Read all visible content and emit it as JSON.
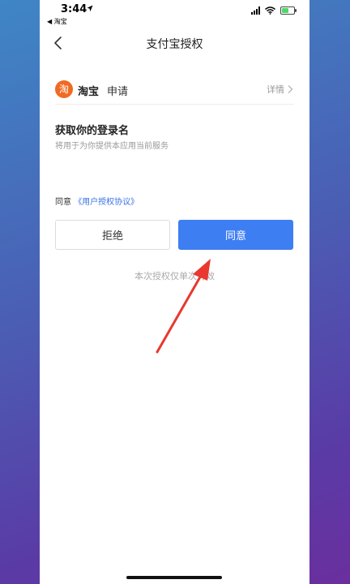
{
  "status_bar": {
    "time": "3:44",
    "back_app": "◀ 淘宝",
    "location_icon": "location-arrow-icon",
    "battery_charging": true,
    "battery_level": 0.6
  },
  "nav": {
    "title": "支付宝授权",
    "back_icon": "chevron-left-icon"
  },
  "app_request": {
    "logo_glyph": "淘",
    "app_name": "淘宝",
    "action": "申请",
    "details_label": "详情"
  },
  "permission": {
    "title": "获取你的登录名",
    "description": "将用于为你提供本应用当前服务"
  },
  "agreement": {
    "prefix": "同意",
    "link_text": "《用户授权协议》"
  },
  "buttons": {
    "reject_label": "拒绝",
    "agree_label": "同意"
  },
  "note": "本次授权仅单次有效",
  "colors": {
    "accent": "#3e7ef3",
    "link": "#3773e6",
    "logo": "#f06a22",
    "annotation_arrow": "#e8382f"
  }
}
